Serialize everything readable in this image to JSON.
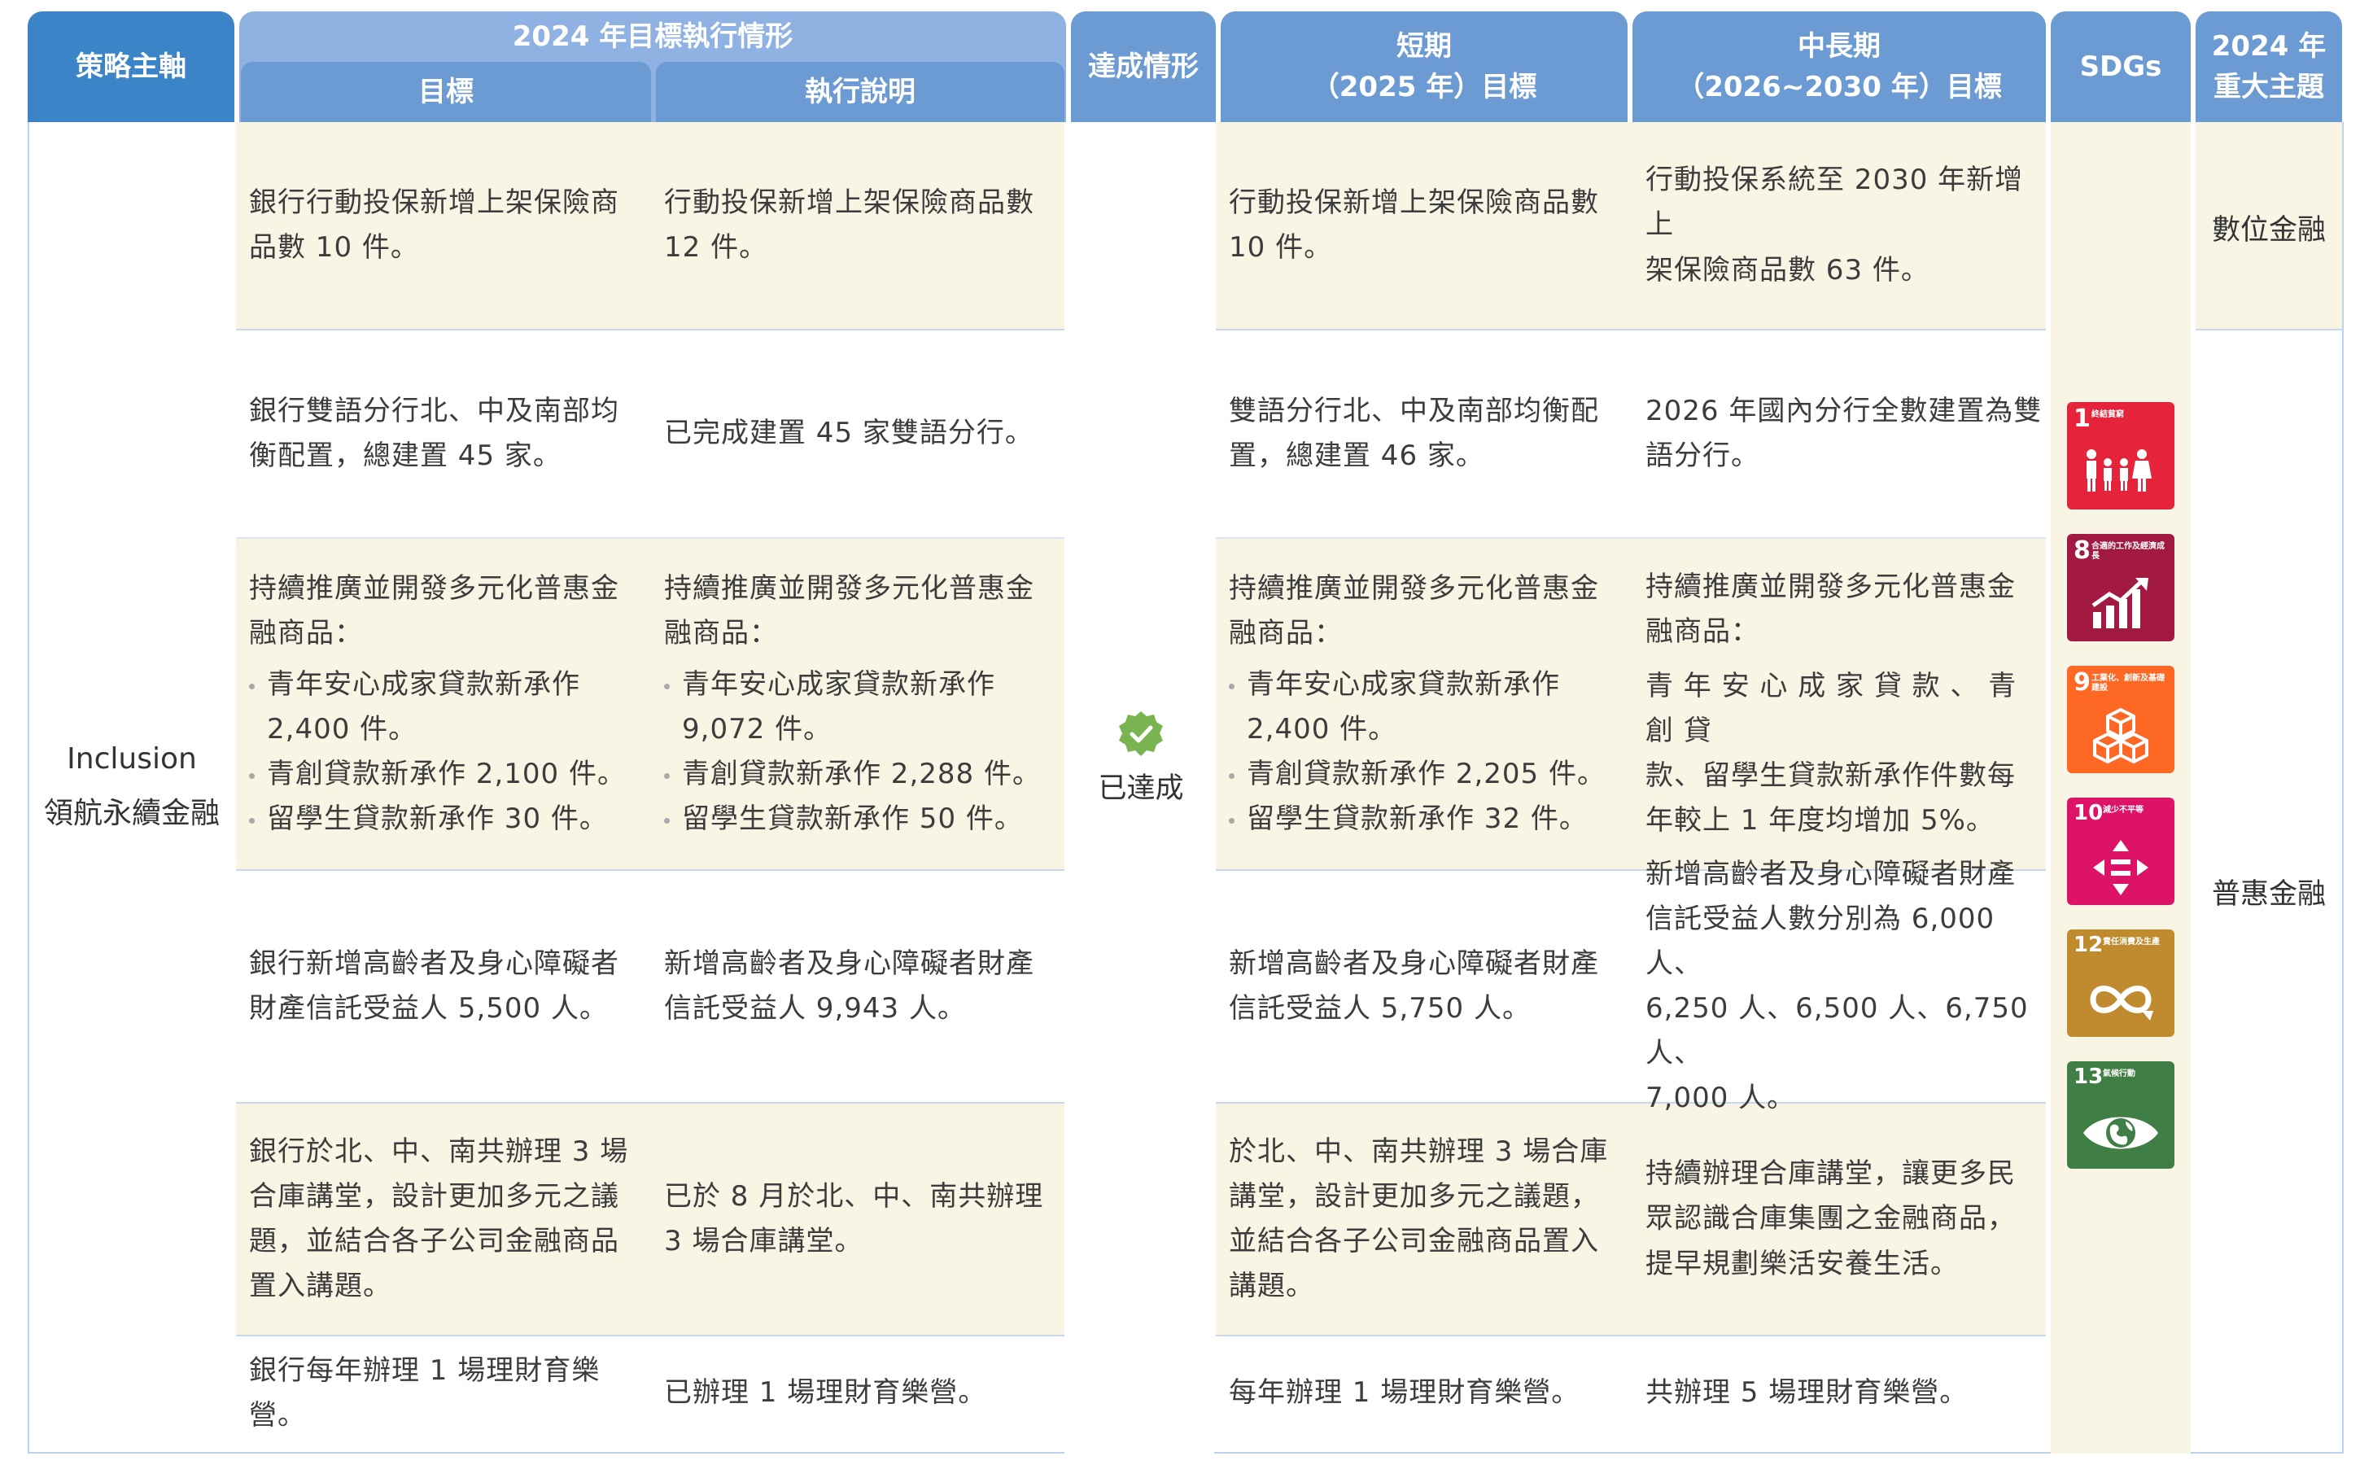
{
  "header": {
    "strategy": "策略主軸",
    "year_group": "2024 年目標執行情形",
    "target": "目標",
    "execution": "執行說明",
    "status": "達成情形",
    "short_term_line1": "短期",
    "short_term_line2": "（2025 年）目標",
    "mid_term_line1": "中長期",
    "mid_term_line2": "（2026~2030 年）目標",
    "sdgs": "SDGs",
    "topic_line1": "2024 年",
    "topic_line2": "重大主題"
  },
  "strategy": {
    "en": "Inclusion",
    "zh": "領航永續金融"
  },
  "status": {
    "label": "已達成",
    "icon": "check-badge-icon",
    "color": "#7ab451"
  },
  "rows": [
    {
      "target": [
        "銀行行動投保新增上架保險商",
        "品數 10 件。"
      ],
      "execution": [
        "行動投保新增上架保險商品數",
        "12 件。"
      ],
      "short": [
        "行動投保新增上架保險商品數",
        "10 件。"
      ],
      "mid": [
        "行動投保系統至 2030 年新增上",
        "架保險商品數 63 件。"
      ]
    },
    {
      "target": [
        "銀行雙語分行北、中及南部均",
        "衡配置，總建置 45 家。"
      ],
      "execution": [
        "已完成建置 45 家雙語分行。"
      ],
      "short": [
        "雙語分行北、中及南部均衡配",
        "置，總建置 46 家。"
      ],
      "mid": [
        "2026 年國內分行全數建置為雙",
        "語分行。"
      ]
    },
    {
      "target_intro": [
        "持續推廣並開發多元化普惠金",
        "融商品："
      ],
      "target_bullets": [
        [
          "青年安心成家貸款新承作",
          "2,400 件。"
        ],
        [
          "青創貸款新承作 2,100 件。"
        ],
        [
          "留學生貸款新承作 30 件。"
        ]
      ],
      "execution_intro": [
        "持續推廣並開發多元化普惠金",
        "融商品："
      ],
      "execution_bullets": [
        [
          "青年安心成家貸款新承作",
          "9,072 件。"
        ],
        [
          "青創貸款新承作 2,288 件。"
        ],
        [
          "留學生貸款新承作 50 件。"
        ]
      ],
      "short_intro": [
        "持續推廣並開發多元化普惠金",
        "融商品："
      ],
      "short_bullets": [
        [
          "青年安心成家貸款新承作",
          "2,400 件。"
        ],
        [
          "青創貸款新承作 2,205 件。"
        ],
        [
          "留學生貸款新承作 32 件。"
        ]
      ],
      "mid_intro": [
        "持續推廣並開發多元化普惠金",
        "融商品："
      ],
      "mid_text": [
        "青 年 安 心 成 家 貸 款 、 青 創 貸",
        "款、留學生貸款新承作件數每",
        "年較上 1 年度均增加 5%。"
      ]
    },
    {
      "target": [
        "銀行新增高齡者及身心障礙者",
        "財產信託受益人 5,500 人。"
      ],
      "execution": [
        "新增高齡者及身心障礙者財產",
        "信託受益人 9,943 人。"
      ],
      "short": [
        "新增高齡者及身心障礙者財產",
        "信託受益人 5,750 人。"
      ],
      "mid": [
        "新增高齡者及身心障礙者財產",
        "信託受益人數分別為 6,000 人、",
        "6,250 人、6,500 人、6,750 人、",
        "7,000 人。"
      ]
    },
    {
      "target": [
        "銀行於北、中、南共辦理 3 場",
        "合庫講堂，設計更加多元之議",
        "題，並結合各子公司金融商品",
        "置入講題。"
      ],
      "execution": [
        "已於 8 月於北、中、南共辦理",
        "3 場合庫講堂。"
      ],
      "short": [
        "於北、中、南共辦理 3 場合庫",
        "講堂，設計更加多元之議題，",
        "並結合各子公司金融商品置入",
        "講題。"
      ],
      "mid": [
        "持續辦理合庫講堂，讓更多民",
        "眾認識合庫集團之金融商品，",
        "提早規劃樂活安養生活。"
      ]
    },
    {
      "target": [
        "銀行每年辦理 1 場理財育樂營。"
      ],
      "execution": [
        "已辦理 1 場理財育樂營。"
      ],
      "short": [
        "每年辦理 1 場理財育樂營。"
      ],
      "mid": [
        "共辦理 5 場理財育樂營。"
      ]
    }
  ],
  "topics": [
    "數位金融",
    "普惠金融"
  ],
  "sdgs": [
    {
      "number": "1",
      "title": "終結貧窮",
      "color": "#e5243b",
      "icon": "family-icon"
    },
    {
      "number": "8",
      "title": "合適的工作及經濟成長",
      "color": "#a21942",
      "icon": "growth-chart-icon"
    },
    {
      "number": "9",
      "title": "工業化、創新及基礎建設",
      "color": "#fd6925",
      "icon": "cubes-icon"
    },
    {
      "number": "10",
      "title": "減少不平等",
      "color": "#dd1367",
      "icon": "equality-icon"
    },
    {
      "number": "12",
      "title": "責任消費及生產",
      "color": "#bf8b2e",
      "icon": "infinity-icon"
    },
    {
      "number": "13",
      "title": "氣候行動",
      "color": "#3f7e44",
      "icon": "eye-globe-icon"
    }
  ]
}
